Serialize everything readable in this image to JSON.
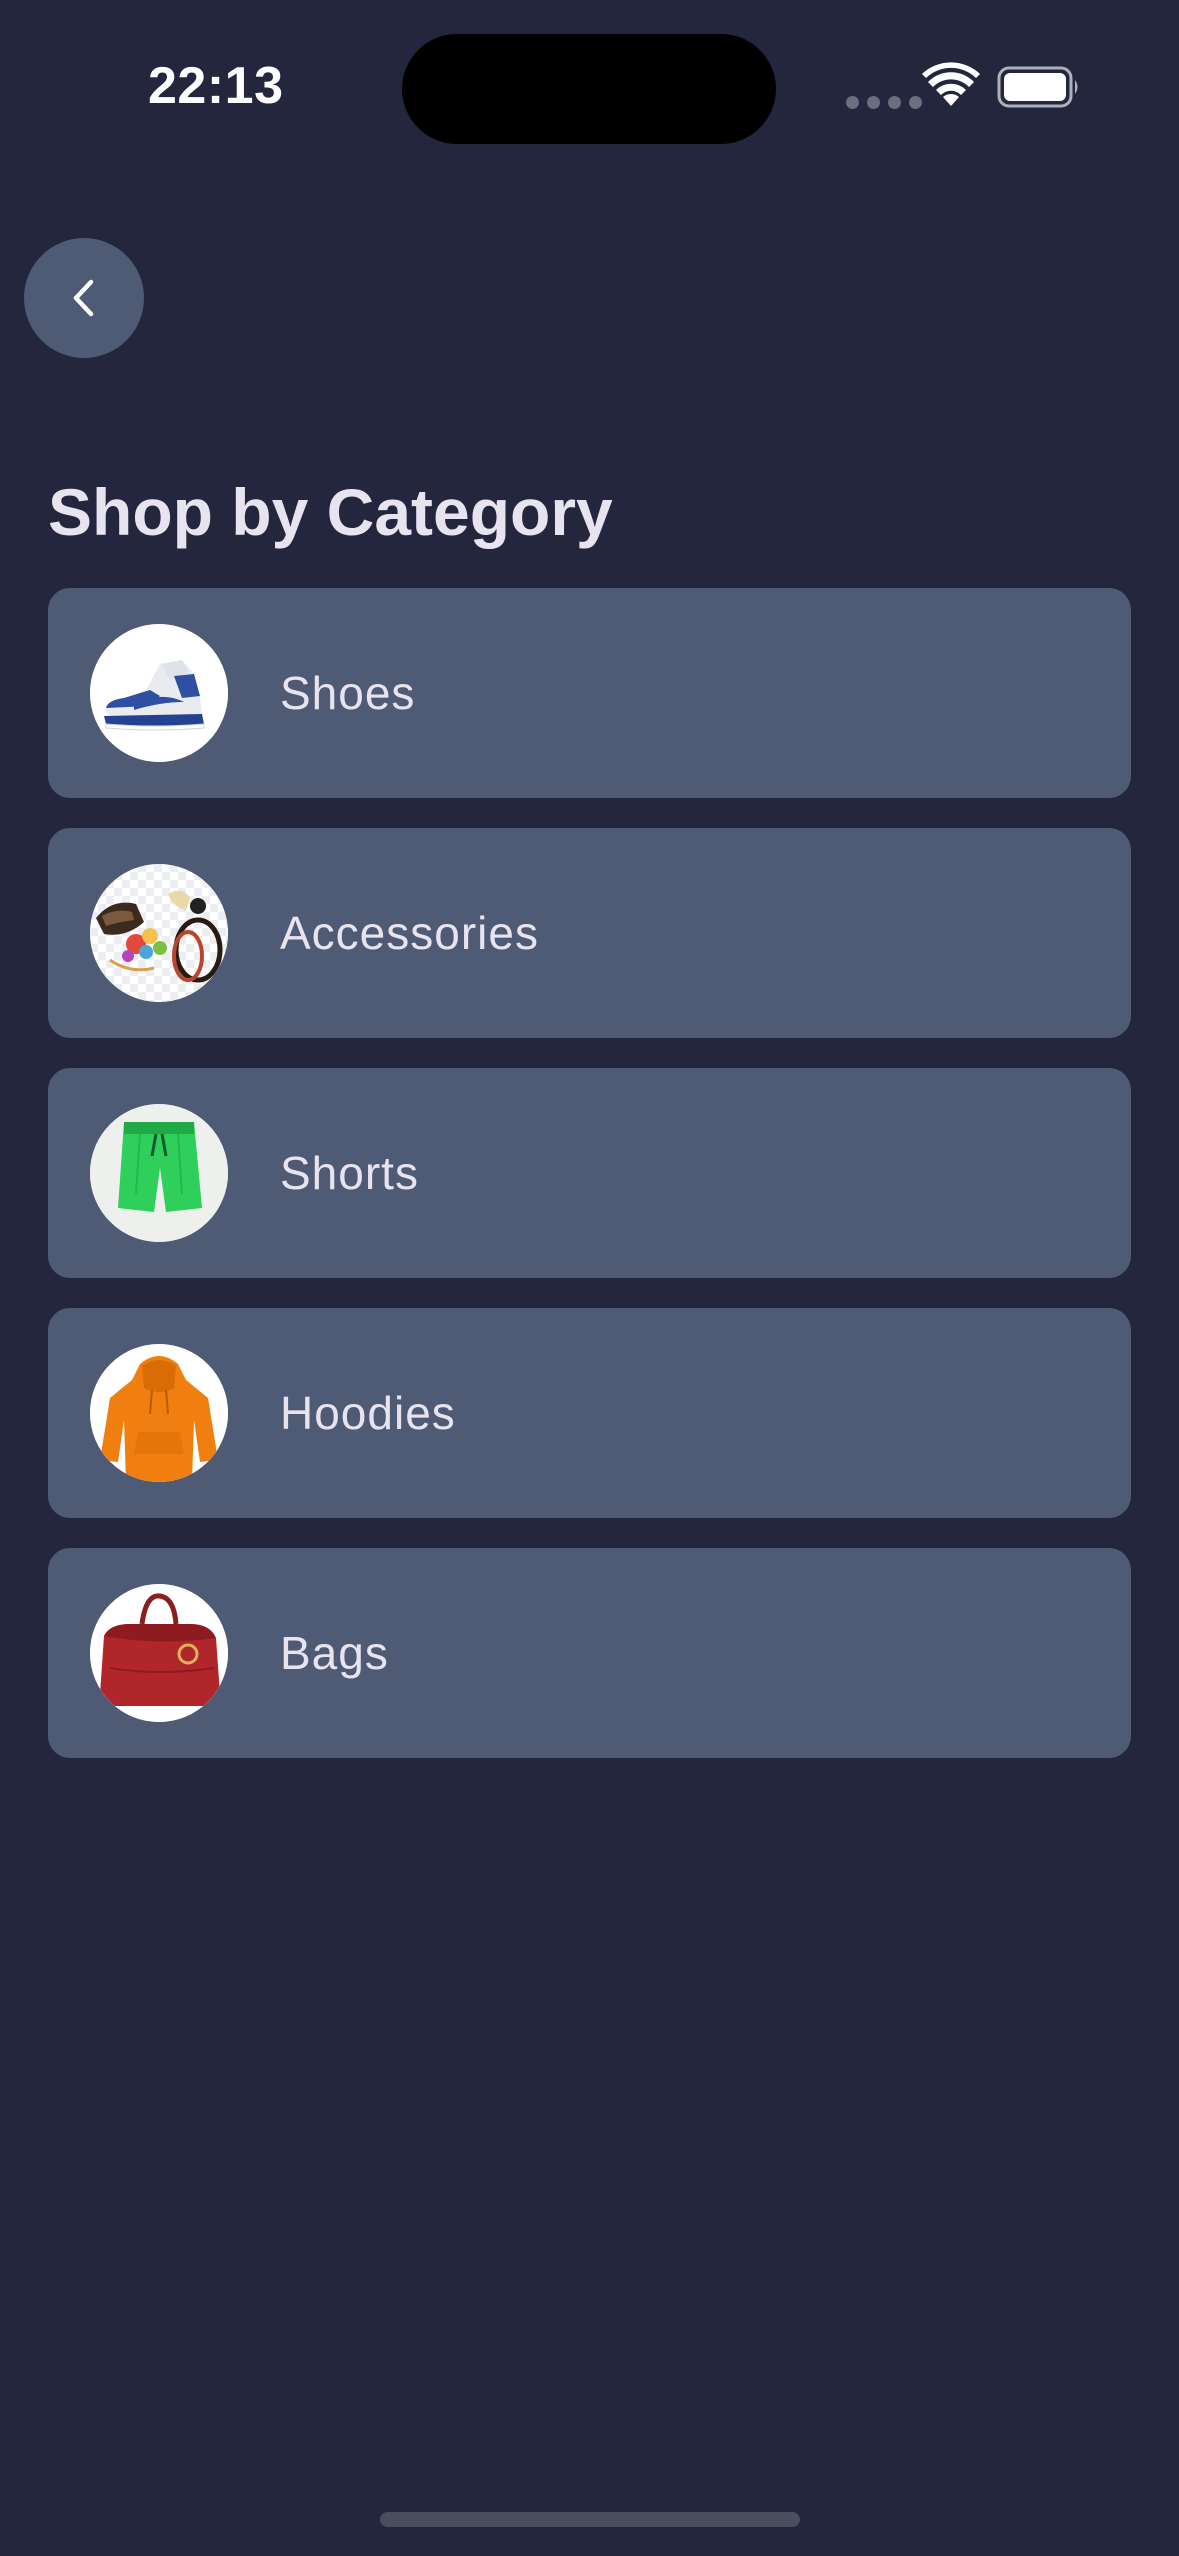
{
  "status_bar": {
    "time": "22:13"
  },
  "header": {
    "back_icon": "chevron-left-icon",
    "title": "Shop by Category"
  },
  "categories": [
    {
      "label": "Shoes",
      "icon": "sneaker-icon"
    },
    {
      "label": "Accessories",
      "icon": "accessories-icon"
    },
    {
      "label": "Shorts",
      "icon": "shorts-icon"
    },
    {
      "label": "Hoodies",
      "icon": "hoodie-icon"
    },
    {
      "label": "Bags",
      "icon": "handbag-icon"
    }
  ],
  "colors": {
    "background": "#23263c",
    "card": "#4f5b74",
    "text": "#e7e4f0"
  }
}
